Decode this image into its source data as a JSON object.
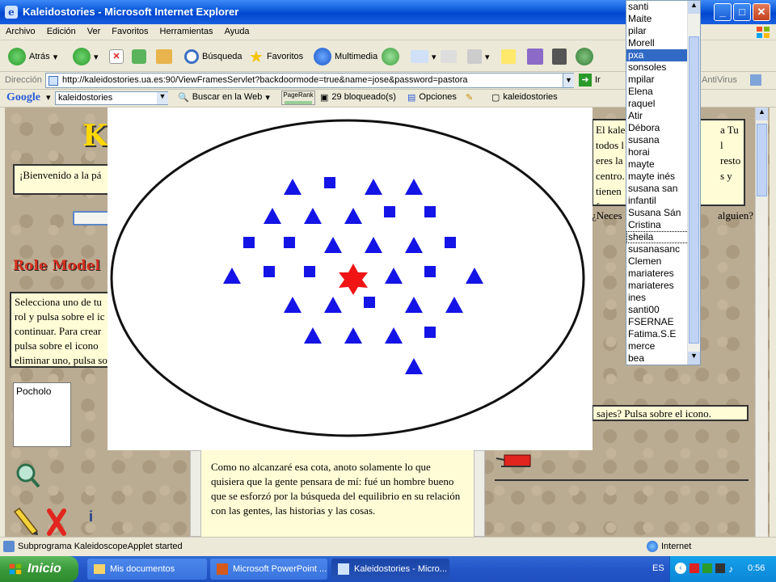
{
  "window": {
    "title": "Kaleidostories - Microsoft Internet Explorer"
  },
  "menu": [
    "Archivo",
    "Edición",
    "Ver",
    "Favoritos",
    "Herramientas",
    "Ayuda"
  ],
  "toolbar": {
    "back": "Atrás",
    "search": "Búsqueda",
    "favorites": "Favoritos",
    "media": "Multimedia"
  },
  "address": {
    "label": "Dirección",
    "url": "http://kaleidostories.ua.es:90/ViewFramesServlet?backdoormode=true&name=jose&password=pastora",
    "go": "Ir",
    "antivirus": "AntiVirus"
  },
  "google": {
    "logo": "Google",
    "query": "kaleidostories",
    "search_web": "Buscar en la Web",
    "pagerank": "PageRank",
    "blocked": "29 bloqueado(s)",
    "options": "Opciones",
    "site": "kaleidostories"
  },
  "page": {
    "logo_letter": "K",
    "welcome": "¡Bienvenido a la pá",
    "role_models": "Role Model",
    "instructions": "Selecciona uno de tu rol y pulsa sobre el ic continuar. Para crear pulsa sobre el icono eliminar uno, pulsa so",
    "list_item": "Pocholo",
    "right_text": "El kale todos l eres la centro. tienen formas",
    "right_text_b": "a Tu l resto s y",
    "question": "¿Neces",
    "question_tail": "alguien?",
    "messages": "sajes? Pulsa sobre el icono.",
    "story": "Como no alcanzaré esa cota, anoto solamente lo que quisiera que la gente pensara de mí: fué un hombre bueno que se esforzó por la búsqueda del equilibrio en su relación con las gentes, las historias y las cosas."
  },
  "userlist": {
    "selected": "pxa",
    "focused": "sheila",
    "items": [
      "santi",
      "Maite",
      "pilar",
      "Morell",
      "pxa",
      "sonsoles",
      "mpilar",
      "Elena",
      "raquel",
      "Atir",
      "Débora",
      "susana",
      "horai",
      "mayte",
      "mayte inés",
      "susana san",
      "infantil",
      "Susana Sán",
      "Cristina",
      "sheila",
      "susanasanc",
      "Clemen",
      "mariateres",
      "mariateres",
      "ines",
      "santi00",
      "FSERNAE",
      "Fatima.S.E",
      "merce",
      "bea"
    ]
  },
  "status": {
    "text": "Subprograma KaleidoscopeApplet started",
    "zone": "Internet"
  },
  "taskbar": {
    "start": "Inicio",
    "tasks": [
      "Mis documentos",
      "Microsoft PowerPoint ...",
      "Kaleidostories - Micro..."
    ],
    "lang": "ES",
    "time": "0:56"
  },
  "colors": {
    "triangle": "#1414e6",
    "square": "#1414e6",
    "center_star": "#f01414",
    "selection": "#316ac5"
  }
}
